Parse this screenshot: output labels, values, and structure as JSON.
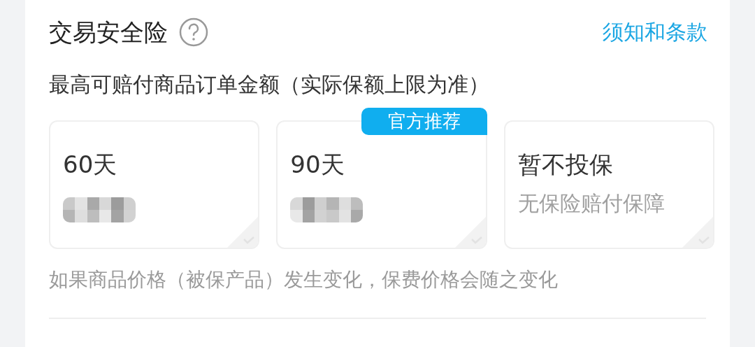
{
  "header": {
    "title": "交易安全险",
    "terms_link": "须知和条款"
  },
  "subtitle": "最高可赔付商品订单金额（实际保额上限为准）",
  "options": [
    {
      "label": "60天",
      "selected": false,
      "price_blurred": true
    },
    {
      "label": "90天",
      "selected": false,
      "price_blurred": true,
      "badge": "官方推荐"
    },
    {
      "label": "暂不投保",
      "selected": false,
      "price_blurred": false,
      "note": "无保险赔付保障"
    }
  ],
  "footnote": "如果商品价格（被保产品）发生变化，保费价格会随之变化"
}
